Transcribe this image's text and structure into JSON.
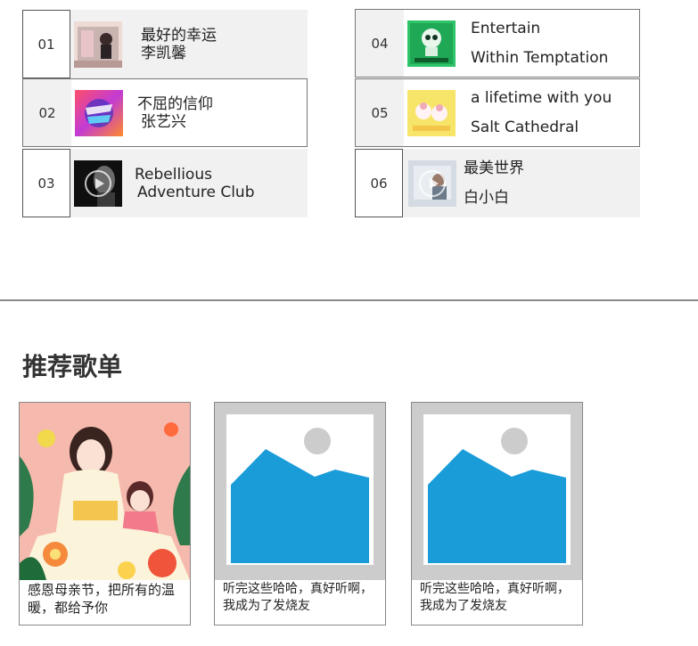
{
  "songs": [
    {
      "num": "01",
      "title": "最好的幸运",
      "artist": "李凯馨",
      "cover_icon": "album-cover-pink-figures"
    },
    {
      "num": "02",
      "title": "不屈的信仰",
      "artist": "张艺兴",
      "cover_icon": "album-cover-colorful-text"
    },
    {
      "num": "03",
      "title": "Rebellious",
      "artist": "Adventure Club",
      "cover_icon": "album-cover-dark-portrait"
    },
    {
      "num": "04",
      "title": "Entertain",
      "artist": "Within Temptation",
      "cover_icon": "album-cover-green-skull"
    },
    {
      "num": "05",
      "title": "a lifetime with you",
      "artist": "Salt Cathedral",
      "cover_icon": "album-cover-yellow-illustration"
    },
    {
      "num": "06",
      "title": "最美世界",
      "artist": "白小白",
      "cover_icon": "album-cover-grey-photo"
    }
  ],
  "playlists_section": {
    "title": "推荐歌单",
    "items": [
      {
        "caption": "感恩母亲节，把所有的温暖，都给予你",
        "image_icon": "mother-daughter-illustration"
      },
      {
        "caption": "听完这些哈哈，真好听啊，我成为了发烧友",
        "image_icon": "image-placeholder-icon"
      },
      {
        "caption": "听完这些哈哈，真好听啊，我成为了发烧友",
        "image_icon": "image-placeholder-icon"
      }
    ]
  },
  "colors": {
    "row_shade": "#f1f1f1",
    "border": "#777777",
    "placeholder_blue": "#1a9cd8",
    "placeholder_frame": "#cccccc"
  }
}
